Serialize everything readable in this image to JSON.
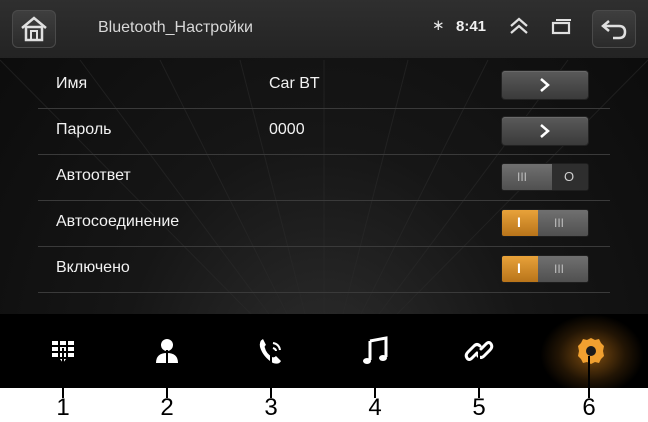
{
  "status_bar": {
    "title": "Bluetooth_Настройки",
    "bluetooth_symbol": "∗",
    "time": "8:41",
    "icons": [
      "home-icon",
      "chevron-up-icon",
      "window-icon",
      "back-icon"
    ]
  },
  "settings": [
    {
      "label": "Имя",
      "value": "Car BT",
      "control": "arrow-button"
    },
    {
      "label": "Пароль",
      "value": "0000",
      "control": "arrow-button"
    },
    {
      "label": "Автоответ",
      "value": "",
      "control": "toggle",
      "state": "off"
    },
    {
      "label": "Автосоединение",
      "value": "",
      "control": "toggle",
      "state": "on"
    },
    {
      "label": "Включено",
      "value": "",
      "control": "toggle",
      "state": "on"
    }
  ],
  "toggle_marks": {
    "on": "I",
    "off": "O",
    "grip": "III"
  },
  "nav": [
    {
      "icon": "dialpad-icon",
      "active": false
    },
    {
      "icon": "contacts-icon",
      "active": false
    },
    {
      "icon": "phone-icon",
      "active": false
    },
    {
      "icon": "music-icon",
      "active": false
    },
    {
      "icon": "link-icon",
      "active": false
    },
    {
      "icon": "settings-gear-icon",
      "active": true
    }
  ],
  "callouts": [
    "1",
    "2",
    "3",
    "4",
    "5",
    "6"
  ],
  "colors": {
    "accent": "#e8a23a",
    "background": "#111111",
    "text": "#f2f2f2"
  }
}
